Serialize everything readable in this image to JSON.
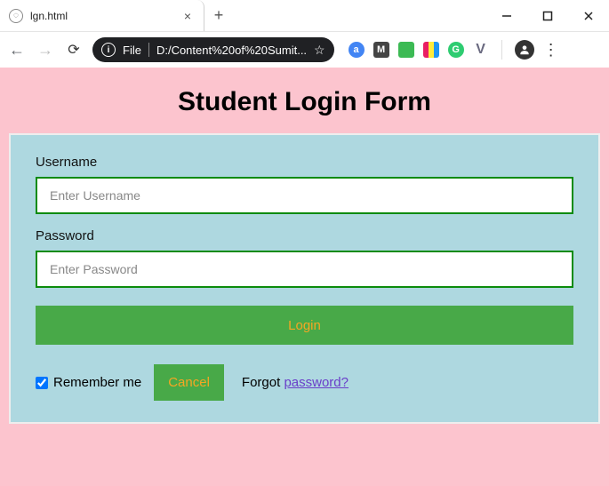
{
  "window": {
    "tab_title": "lgn.html"
  },
  "toolbar": {
    "file_label": "File",
    "url": "D:/Content%20of%20Sumit..."
  },
  "page": {
    "title": "Student Login Form",
    "username_label": "Username",
    "username_placeholder": "Enter Username",
    "password_label": "Password",
    "password_placeholder": "Enter Password",
    "login_button": "Login",
    "remember_label": "Remember me",
    "cancel_button": "Cancel",
    "forgot_prefix": "Forgot ",
    "forgot_link": "password?"
  }
}
